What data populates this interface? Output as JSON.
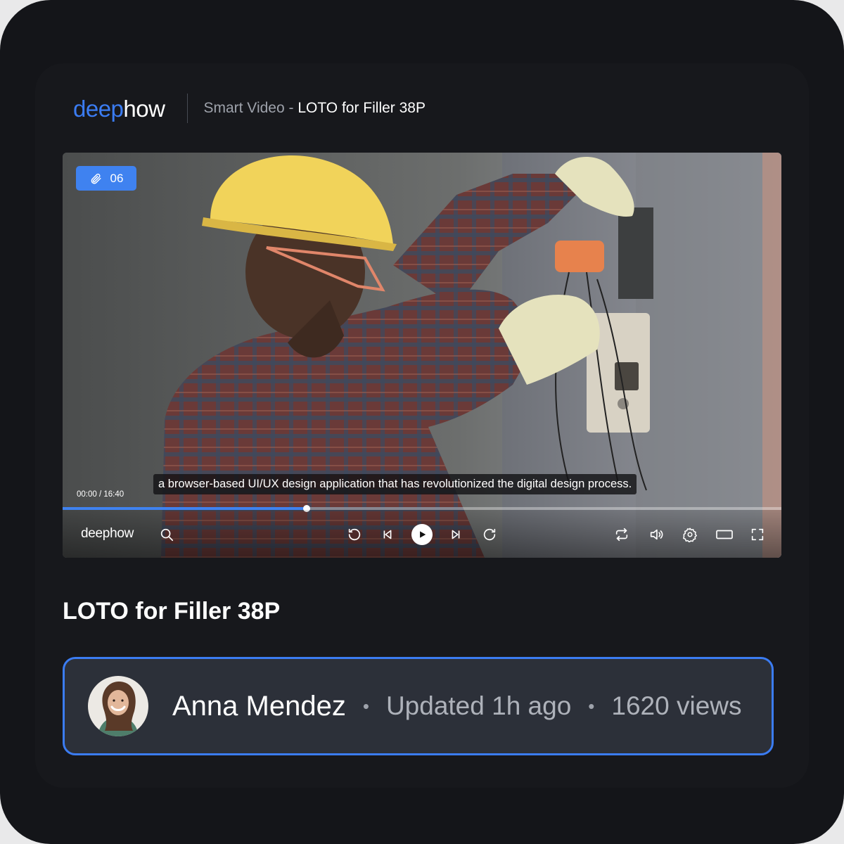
{
  "header": {
    "logo_part1": "deep",
    "logo_part2": "how",
    "section": "Smart Video - ",
    "video_name": "LOTO for Filler 38P"
  },
  "player": {
    "attachments_count": "06",
    "subtitle": "a browser-based UI/UX design application that has revolutionized the digital design process.",
    "time": "00:00 / 16:40",
    "progress": 0.34,
    "logo": "deephow",
    "controls": [
      "search-icon",
      "rewind-icon",
      "previous-icon",
      "play-icon",
      "next-icon",
      "forward-icon",
      "loop-icon",
      "volume-icon",
      "settings-icon",
      "theater-icon",
      "fullscreen-icon"
    ]
  },
  "video_title": "LOTO for Filler 38P",
  "author": {
    "name": "Anna Mendez",
    "updated": "Updated 1h ago",
    "views": "1620 views",
    "separator": "•"
  },
  "colors": {
    "accent": "#3b7cf2",
    "background": "#141519",
    "card": "#2c3039"
  }
}
